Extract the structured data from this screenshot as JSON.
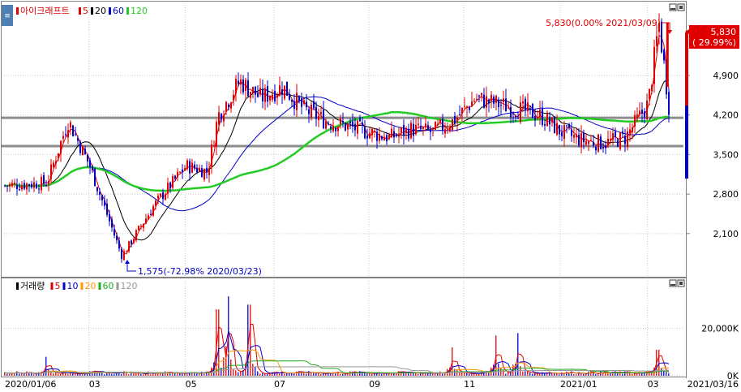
{
  "chart_data": [
    {
      "type": "candlestick",
      "name": "아이크래프트",
      "legend": [
        {
          "label": "아이크래프트",
          "color": "#e00000"
        },
        {
          "label": "5",
          "color": "#e00000"
        },
        {
          "label": "20",
          "color": "#000000"
        },
        {
          "label": "60",
          "color": "#0000cc"
        },
        {
          "label": "120",
          "color": "#22cc22"
        }
      ],
      "ylim": [
        1350,
        6150
      ],
      "y_ticks": [
        2100,
        2800,
        3500,
        4200,
        4900
      ],
      "y_tick_labels": [
        "2,100",
        "2,800",
        "3,500",
        "4,200",
        "4,900"
      ],
      "x_tick_labels": [
        "2020/01/06",
        "03",
        "05",
        "07",
        "09",
        "11",
        "2021/01",
        "03"
      ],
      "end_date_label": "2021/03/16",
      "horizontal_lines": [
        4150,
        3650
      ],
      "last_price_label": "5,830",
      "last_change_label": "( 29.99%)",
      "high_annotation": "5,830(0.00% 2021/03/09)",
      "low_annotation": "1,575(-72.98% 2020/03/23)",
      "approx_close_path": {
        "dates": [
          "2020/01/06",
          "2020/02/03",
          "2020/02/17",
          "2020/03/02",
          "2020/03/23",
          "2020/04/13",
          "2020/05/04",
          "2020/05/18",
          "2020/05/25",
          "2020/06/08",
          "2020/06/22",
          "2020/07/06",
          "2020/07/20",
          "2020/08/03",
          "2020/08/17",
          "2020/08/31",
          "2020/09/14",
          "2020/09/28",
          "2020/10/12",
          "2020/10/26",
          "2020/11/09",
          "2020/11/23",
          "2020/12/07",
          "2020/12/21",
          "2021/01/04",
          "2021/01/18",
          "2021/02/01",
          "2021/02/15",
          "2021/03/02",
          "2021/03/09",
          "2021/03/16"
        ],
        "close": [
          2950,
          3000,
          4100,
          3300,
          1700,
          2600,
          3300,
          3200,
          4200,
          4800,
          4500,
          4700,
          4300,
          4100,
          4000,
          3900,
          3800,
          3950,
          3900,
          4100,
          4500,
          4400,
          4300,
          4200,
          3900,
          3750,
          3700,
          3800,
          4400,
          5830,
          4250
        ]
      }
    },
    {
      "type": "bar",
      "name": "거래량",
      "legend": [
        {
          "label": "거래량",
          "color": "#000000"
        },
        {
          "label": "5",
          "color": "#e00000"
        },
        {
          "label": "10",
          "color": "#0000cc"
        },
        {
          "label": "20",
          "color": "#ff9900"
        },
        {
          "label": "60",
          "color": "#22aa22"
        },
        {
          "label": "120",
          "color": "#999999"
        }
      ],
      "ylim": [
        0,
        38000
      ],
      "y_ticks": [
        0,
        20000
      ],
      "y_tick_labels": [
        "0K",
        "20,000K"
      ],
      "approx_volume_spikes": [
        {
          "date": "2020/02/03",
          "volume": 8000
        },
        {
          "date": "2020/05/25",
          "volume": 28000
        },
        {
          "date": "2020/06/01",
          "volume": 33500
        },
        {
          "date": "2020/06/15",
          "volume": 30000
        },
        {
          "date": "2020/10/26",
          "volume": 12000
        },
        {
          "date": "2020/11/23",
          "volume": 17000
        },
        {
          "date": "2020/12/07",
          "volume": 18000
        },
        {
          "date": "2021/03/09",
          "volume": 11000
        }
      ]
    }
  ]
}
